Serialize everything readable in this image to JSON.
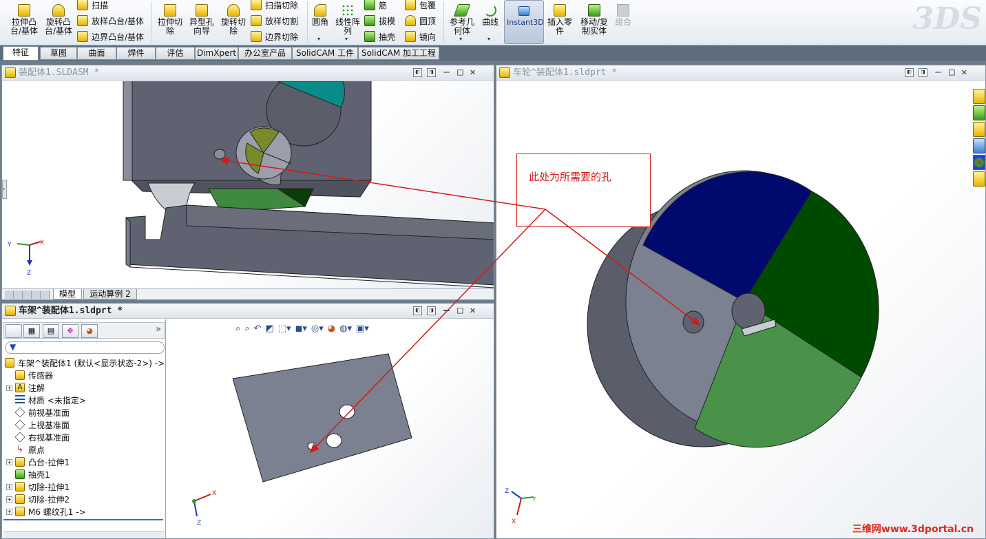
{
  "ribbon": {
    "extrude_boss": "拉伸凸\n台/基体",
    "revolve_boss": "旋转凸\n台/基体",
    "sweep": "扫描",
    "loft_boss": "放样凸台/基体",
    "boundary_boss": "边界凸台/基体",
    "extrude_cut": "拉伸切\n除",
    "hole_wizard": "异型孔\n向导",
    "revolve_cut": "旋转切\n除",
    "swept_cut": "扫描切除",
    "lofted_cut": "放样切割",
    "boundary_cut": "边界切除",
    "fillet": "圆角",
    "linear_pattern": "线性阵\n列",
    "rib": "筋",
    "draft": "拔模",
    "shell": "抽壳",
    "wrap": "包覆",
    "dome": "圆顶",
    "mirror": "镜向",
    "ref_geometry": "参考几\n何体",
    "curves": "曲线",
    "instant3d": "Instant3D",
    "insert_part": "插入零\n件",
    "move_copy": "移动/复\n制实体",
    "combine": "组合"
  },
  "tabs": [
    "特征",
    "草图",
    "曲面",
    "焊件",
    "评估",
    "DimXpert",
    "办公室产品",
    "SolidCAM 工件",
    "SolidCAM 加工工程"
  ],
  "windows": {
    "assembly": {
      "title": "装配体1.SLDASM *",
      "bottom_tabs": [
        "模型",
        "运动算例 2"
      ]
    },
    "wheel": {
      "title": "车轮^装配体1.sldprt *"
    },
    "frame": {
      "title": "车架^装配体1.sldprt *"
    }
  },
  "feature_tree": {
    "items": [
      {
        "label": "车架^装配体1  (默认<显示状态-2>) ->",
        "expand": ""
      },
      {
        "label": "传感器",
        "expand": ""
      },
      {
        "label": "注解",
        "expand": "+"
      },
      {
        "label": "材质 <未指定>",
        "expand": ""
      },
      {
        "label": "前视基准面",
        "expand": ""
      },
      {
        "label": "上视基准面",
        "expand": ""
      },
      {
        "label": "右视基准面",
        "expand": ""
      },
      {
        "label": "原点",
        "expand": ""
      },
      {
        "label": "凸台-拉伸1",
        "expand": "+"
      },
      {
        "label": "抽壳1",
        "expand": ""
      },
      {
        "label": "切除-拉伸1",
        "expand": "+"
      },
      {
        "label": "切除-拉伸2",
        "expand": "+"
      },
      {
        "label": "M6 螺纹孔1 ->",
        "expand": "+"
      }
    ],
    "collapse": "»"
  },
  "annotation": {
    "text": "此处为所需要的孔"
  },
  "watermark": "三维网www.3dportal.cn",
  "colors": {
    "body_grey": "#5f6371",
    "wheel_blue": "#000a6e",
    "wheel_dkgreen": "#004a00",
    "wheel_green": "#4a914a",
    "wheel_face_grey": "#7c8191",
    "teal": "#0b8a8a",
    "olive": "#7a8a2a",
    "annotation_red": "#d21b1b"
  }
}
